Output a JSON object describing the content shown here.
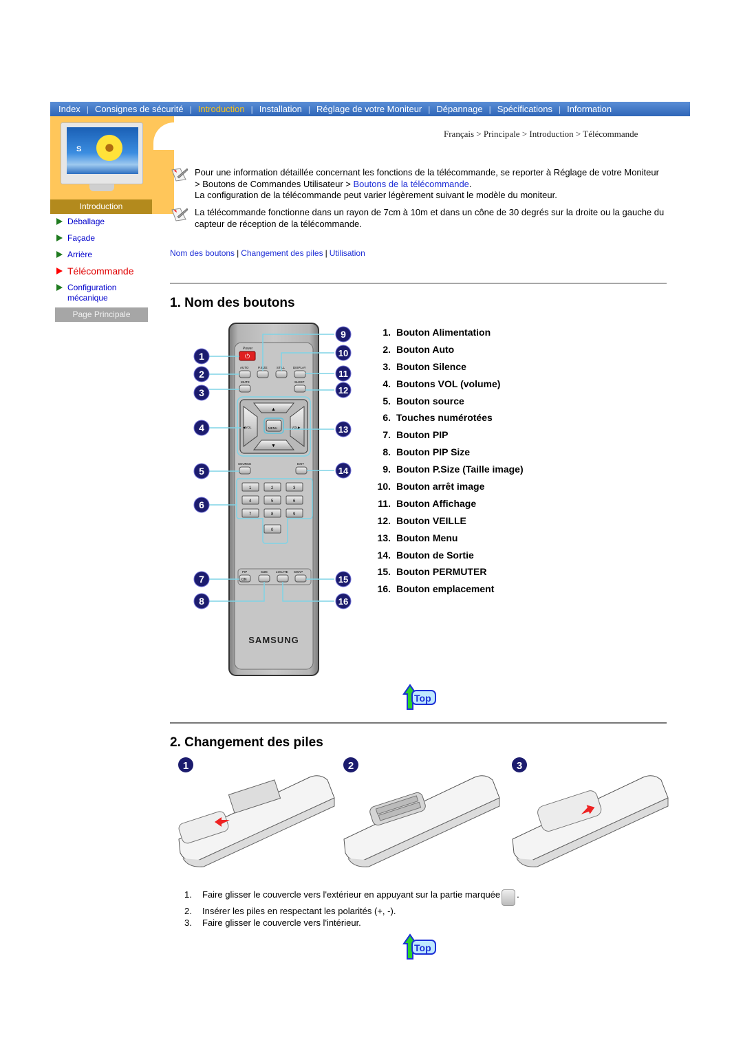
{
  "topnav": {
    "items": [
      {
        "label": "Index",
        "active": false
      },
      {
        "label": "Consignes de sécurité",
        "active": false
      },
      {
        "label": "Introduction",
        "active": true
      },
      {
        "label": "Installation",
        "active": false
      },
      {
        "label": "Réglage de votre Moniteur",
        "active": false
      },
      {
        "label": "Dépannage",
        "active": false
      },
      {
        "label": "Spécifications",
        "active": false
      },
      {
        "label": "Information",
        "active": false
      }
    ]
  },
  "sidebar": {
    "section_label": "Introduction",
    "items": [
      {
        "label": "Déballage",
        "active": false
      },
      {
        "label": "Façade",
        "active": false
      },
      {
        "label": "Arrière",
        "active": false
      },
      {
        "label": "Télécommande",
        "active": true
      },
      {
        "label": "Configuration mécanique",
        "active": false
      }
    ],
    "home_button": "Page Principale"
  },
  "breadcrumb": "Français > Principale > Introduction > Télécommande",
  "notes": [
    {
      "text_before": "Pour une information détaillée concernant les fonctions de la télécommande, se reporter à Réglage de votre Moniteur > Boutons de Commandes Utilisateur > ",
      "link": "Boutons de la télécommande",
      "text_after": ".",
      "line2": "La configuration de la télécommande peut varier légèrement suivant le modèle du moniteur."
    },
    {
      "text": "La télécommande fonctionne dans un rayon de 7cm à 10m et dans un cône de 30 degrés sur la droite ou la gauche du capteur de réception de la télécommande."
    }
  ],
  "subnav": [
    "Nom des boutons",
    "Changement des piles",
    "Utilisation"
  ],
  "section1": {
    "title": "1. Nom des boutons",
    "buttons": [
      {
        "num": "1.",
        "label": "Bouton Alimentation"
      },
      {
        "num": "2.",
        "label": "Bouton Auto"
      },
      {
        "num": "3.",
        "label": "Bouton Silence"
      },
      {
        "num": "4.",
        "label": "Boutons VOL (volume)"
      },
      {
        "num": "5.",
        "label": "Bouton source"
      },
      {
        "num": "6.",
        "label": "Touches numérotées"
      },
      {
        "num": "7.",
        "label": "Bouton PIP"
      },
      {
        "num": "8.",
        "label": "Bouton PIP Size"
      },
      {
        "num": "9.",
        "label": "Bouton P.Size (Taille image)"
      },
      {
        "num": "10.",
        "label": "Bouton arrêt image"
      },
      {
        "num": "11.",
        "label": "Bouton Affichage"
      },
      {
        "num": "12.",
        "label": "Bouton VEILLE"
      },
      {
        "num": "13.",
        "label": "Bouton Menu"
      },
      {
        "num": "14.",
        "label": "Bouton de Sortie"
      },
      {
        "num": "15.",
        "label": "Bouton PERMUTER"
      },
      {
        "num": "16.",
        "label": "Bouton emplacement"
      }
    ],
    "remote_labels": {
      "power": "Power",
      "auto": "AUTO",
      "psize": "P.SIZE",
      "still": "STILL",
      "display": "DISPLAY",
      "mute": "MUTE",
      "sleep": "SLEEP",
      "vol_left": "◀VOL",
      "vol_right": "VOL▶",
      "menu": "MENU",
      "source": "SOURCE",
      "exit": "EXIT",
      "pip": "PIP",
      "on": "ON",
      "size": "SIZE",
      "locate": "LOCATE",
      "swap": "SWAP",
      "brand": "SAMSUNG",
      "digits": [
        "1",
        "2",
        "3",
        "4",
        "5",
        "6",
        "7",
        "8",
        "9",
        "0"
      ]
    },
    "callouts": [
      "1",
      "2",
      "3",
      "4",
      "5",
      "6",
      "7",
      "8",
      "9",
      "10",
      "11",
      "12",
      "13",
      "14",
      "15",
      "16"
    ]
  },
  "top_link": "Top",
  "section2": {
    "title": "2. Changement des piles",
    "step_badges": [
      "1",
      "2",
      "3"
    ],
    "steps": [
      {
        "num": "1.",
        "text": "Faire glisser le couvercle vers l'extérieur en appuyant sur la partie marquée",
        "suffix": "."
      },
      {
        "num": "2.",
        "text": "Insérer les piles en respectant les polarités (+, -)."
      },
      {
        "num": "3.",
        "text": "Faire glisser le couvercle vers l'intérieur."
      }
    ]
  },
  "colors": {
    "nav_blue": "#2f66b8",
    "nav_active": "#f8c21a",
    "link_blue": "#1e2ed6",
    "active_red": "#e00000",
    "badge_navy": "#1c1c6e",
    "callout_line": "#7fd3e6"
  }
}
